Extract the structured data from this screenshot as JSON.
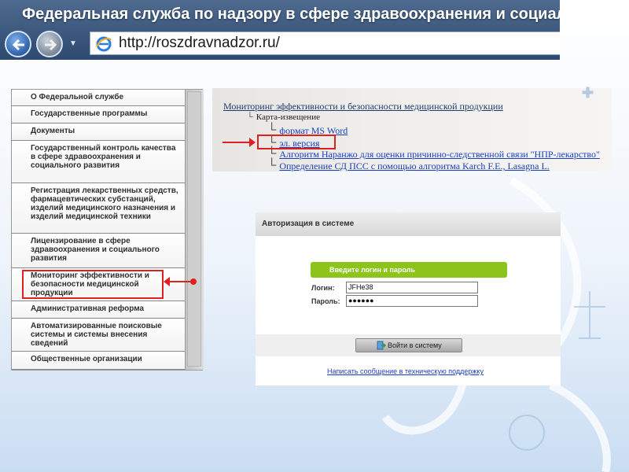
{
  "browser": {
    "title": "Федеральная служба по надзору в сфере здравоохранения и социального развития -",
    "url": "http://roszdravnadzor.ru/"
  },
  "sidebar": {
    "items": [
      {
        "label": "О Федеральной службе"
      },
      {
        "label": "Государственные программы"
      },
      {
        "label": "Документы"
      },
      {
        "label": "Государственный контроль качества в сфере здравоохранения и социального развития"
      },
      {
        "label": "Регистрация лекарственных средств, фармацевтических субстанций, изделий медицинского назначения и изделий медицинской техники"
      },
      {
        "label": "Лицензирование в сфере здравоохранения и социального развития"
      },
      {
        "label": "Мониторинг эффективности и безопасности медицинской продукции"
      },
      {
        "label": "Административная реформа"
      },
      {
        "label": "Автоматизированные поисковые системы и системы внесения сведений"
      },
      {
        "label": "Общественные организации"
      }
    ]
  },
  "sitemap": {
    "root": "Мониторинг эффективности и безопасности медицинской продукции",
    "card": "Карта-извещение",
    "links": [
      {
        "label": "формат MS Word"
      },
      {
        "label": "эл. версия"
      },
      {
        "label": "Алгоритм Наранжо для оценки причинно-следственной связи \"НПР-лекарство\""
      },
      {
        "label": "Определение СД ПСС с помощью алгоритма Karch F.E., Lasagna L."
      }
    ]
  },
  "login": {
    "header": "Авторизация в системе",
    "prompt": "Введите логин и пароль",
    "login_label": "Логин:",
    "login_value": "JFHe38",
    "password_label": "Пароль:",
    "password_value": "●●●●●●",
    "submit_label": "Войти в систему",
    "support_link": "Написать сообщение в техническую поддержку"
  },
  "colors": {
    "accent_green": "#8cc41c",
    "highlight_red": "#e02020",
    "link_blue": "#1a3fbf"
  }
}
